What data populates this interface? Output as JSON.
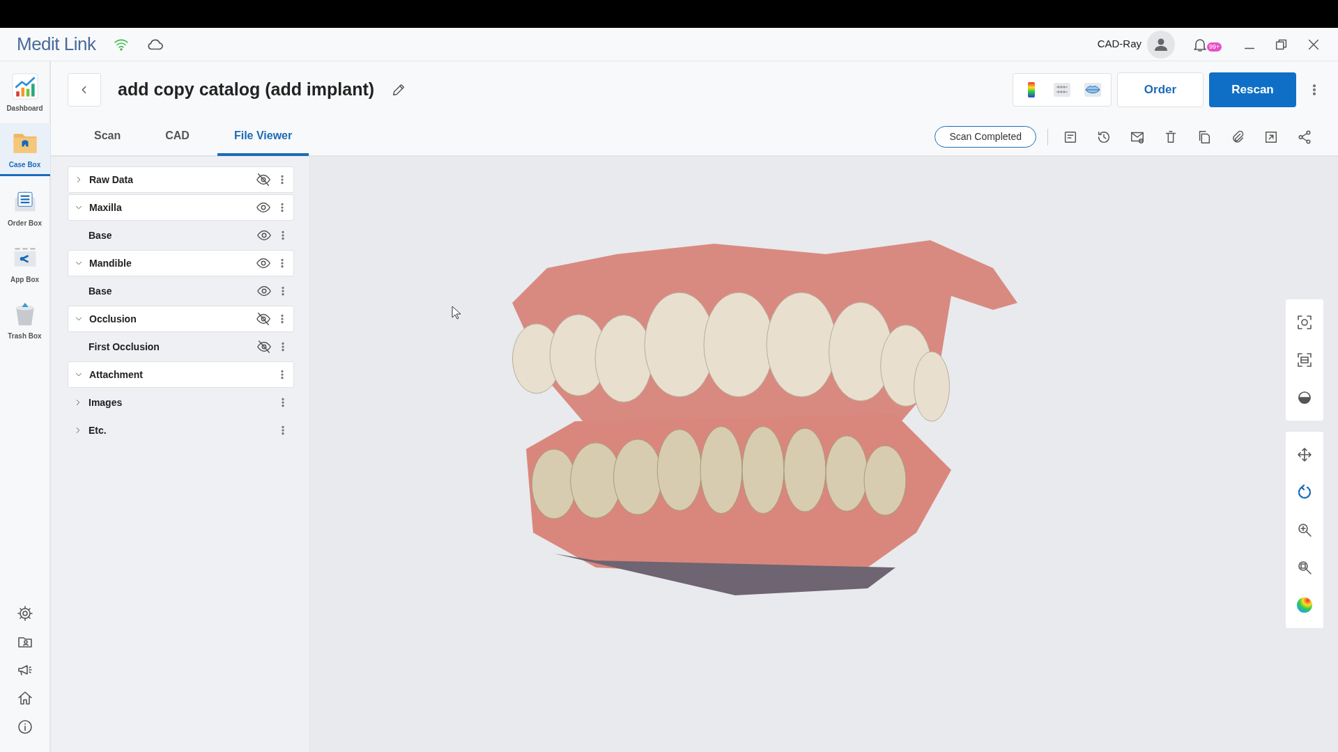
{
  "app": {
    "logo": "Medit Link",
    "user": "CAD-Ray",
    "notification_badge": "99+"
  },
  "sidebar": {
    "items": [
      {
        "label": "Dashboard",
        "kind": "dashboard",
        "selected": false
      },
      {
        "label": "Case Box",
        "kind": "case",
        "selected": true
      },
      {
        "label": "Order Box",
        "kind": "order",
        "selected": false
      },
      {
        "label": "App Box",
        "kind": "app",
        "selected": false
      },
      {
        "label": "Trash Box",
        "kind": "trash",
        "selected": false
      }
    ]
  },
  "case": {
    "title": "add copy catalog (add implant)",
    "status": "Scan Completed",
    "buttons": [
      "Order",
      "Rescan"
    ]
  },
  "tabs": [
    {
      "label": "Scan",
      "selected": false
    },
    {
      "label": "CAD",
      "selected": false
    },
    {
      "label": "File Viewer",
      "selected": true
    }
  ],
  "tree": [
    {
      "label": "Raw Data",
      "kind": "group",
      "expanded": false,
      "visible": false
    },
    {
      "label": "Maxilla",
      "kind": "group",
      "expanded": true,
      "visible": true
    },
    {
      "label": "Base",
      "kind": "child",
      "visible": true
    },
    {
      "label": "Mandible",
      "kind": "group",
      "expanded": true,
      "visible": true
    },
    {
      "label": "Base",
      "kind": "child",
      "visible": true
    },
    {
      "label": "Occlusion",
      "kind": "group",
      "expanded": true,
      "visible": false
    },
    {
      "label": "First Occlusion",
      "kind": "child",
      "visible": false
    },
    {
      "label": "Attachment",
      "kind": "group",
      "expanded": true
    },
    {
      "label": "Images",
      "kind": "empty-group",
      "expanded": false
    },
    {
      "label": "Etc.",
      "kind": "empty-group",
      "expanded": false
    }
  ],
  "view_tools": [
    {
      "selected": false
    },
    {
      "selected": true
    },
    {
      "selected": false
    },
    {
      "selected": false
    },
    {
      "selected": false
    }
  ]
}
